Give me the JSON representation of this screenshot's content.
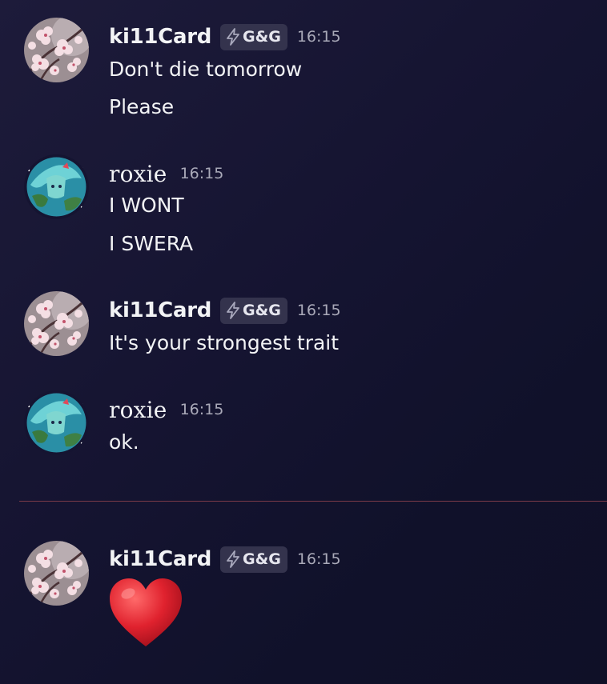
{
  "messages": [
    {
      "author": "ki11Card",
      "tag": "G&G",
      "time": "16:15",
      "lines": [
        "Don't die tomorrow",
        "Please"
      ],
      "avatar_icon": "cherry-blossom-avatar"
    },
    {
      "author": "roxie",
      "tag": "",
      "time": "16:15",
      "lines": [
        "I WONT",
        "I SWERA"
      ],
      "avatar_icon": "anime-globe-avatar"
    },
    {
      "author": "ki11Card",
      "tag": "G&G",
      "time": "16:15",
      "lines": [
        "It's your strongest trait"
      ],
      "avatar_icon": "cherry-blossom-avatar"
    },
    {
      "author": "roxie",
      "tag": "",
      "time": "16:15",
      "lines": [
        "ok."
      ],
      "avatar_icon": "anime-globe-avatar"
    },
    {
      "author": "ki11Card",
      "tag": "G&G",
      "time": "16:15",
      "emoji": "red-heart-emoji",
      "avatar_icon": "cherry-blossom-avatar"
    }
  ],
  "divider": "new-messages-divider",
  "colors": {
    "background": "#151431",
    "divider": "#7a3a48",
    "tag_background": "#34334d",
    "timestamp": "#a9a9b8",
    "text": "#f2f3f5",
    "heart": "#e0222e"
  }
}
